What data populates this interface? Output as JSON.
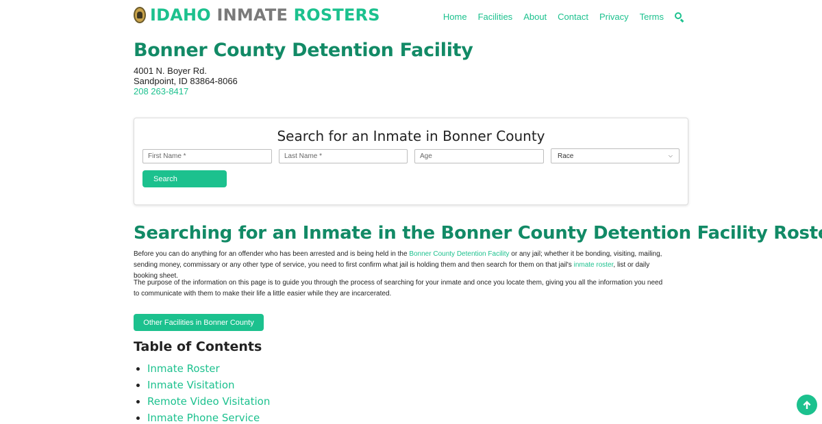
{
  "header": {
    "logo_parts": [
      "IDAHO",
      "INMATE",
      "ROSTERS"
    ],
    "nav": [
      "Home",
      "Facilities",
      "About",
      "Contact",
      "Privacy",
      "Terms"
    ]
  },
  "facility": {
    "name": "Bonner County Detention Facility",
    "address_line1": "4001 N. Boyer Rd.",
    "address_line2": "Sandpoint, ID 83864-8066",
    "phone": "208 263-8417"
  },
  "search": {
    "title": "Search for an Inmate in Bonner County",
    "first_name_placeholder": "First Name *",
    "last_name_placeholder": "Last Name *",
    "age_placeholder": "Age",
    "race_selected": "Race",
    "button": "Search"
  },
  "article": {
    "title": "Searching for an Inmate in the Bonner County Detention Facility Roster",
    "p1_a": "Before you can do anything for an offender who has been arrested and is being held in the ",
    "p1_link1": "Bonner County Detention Facility",
    "p1_b": " or any jail; whether it be bonding, visiting, mailing, sending money, commissary or any other type of service, you need to first confirm what jail is holding them and then search for them on that jail's ",
    "p1_link2": "inmate roster",
    "p1_c": ", list or daily booking sheet.",
    "p2": "The purpose of the information on this page is to guide you through the process of searching for your inmate and once you locate them, giving you all the information you need to communicate with them to make their life a little easier while they are incarcerated.",
    "facilities_button": "Other Facilities in Bonner County"
  },
  "toc": {
    "title": "Table of Contents",
    "items": [
      "Inmate Roster",
      "Inmate Visitation",
      "Remote Video Visitation",
      "Inmate Phone Service"
    ]
  },
  "colors": {
    "accent": "#1cc18e",
    "heading": "#128a66",
    "logo_gray": "#7a7a7a"
  },
  "icons": [
    "badge-logo-icon",
    "search-icon",
    "arrow-up-icon",
    "chevron-down-icon"
  ]
}
